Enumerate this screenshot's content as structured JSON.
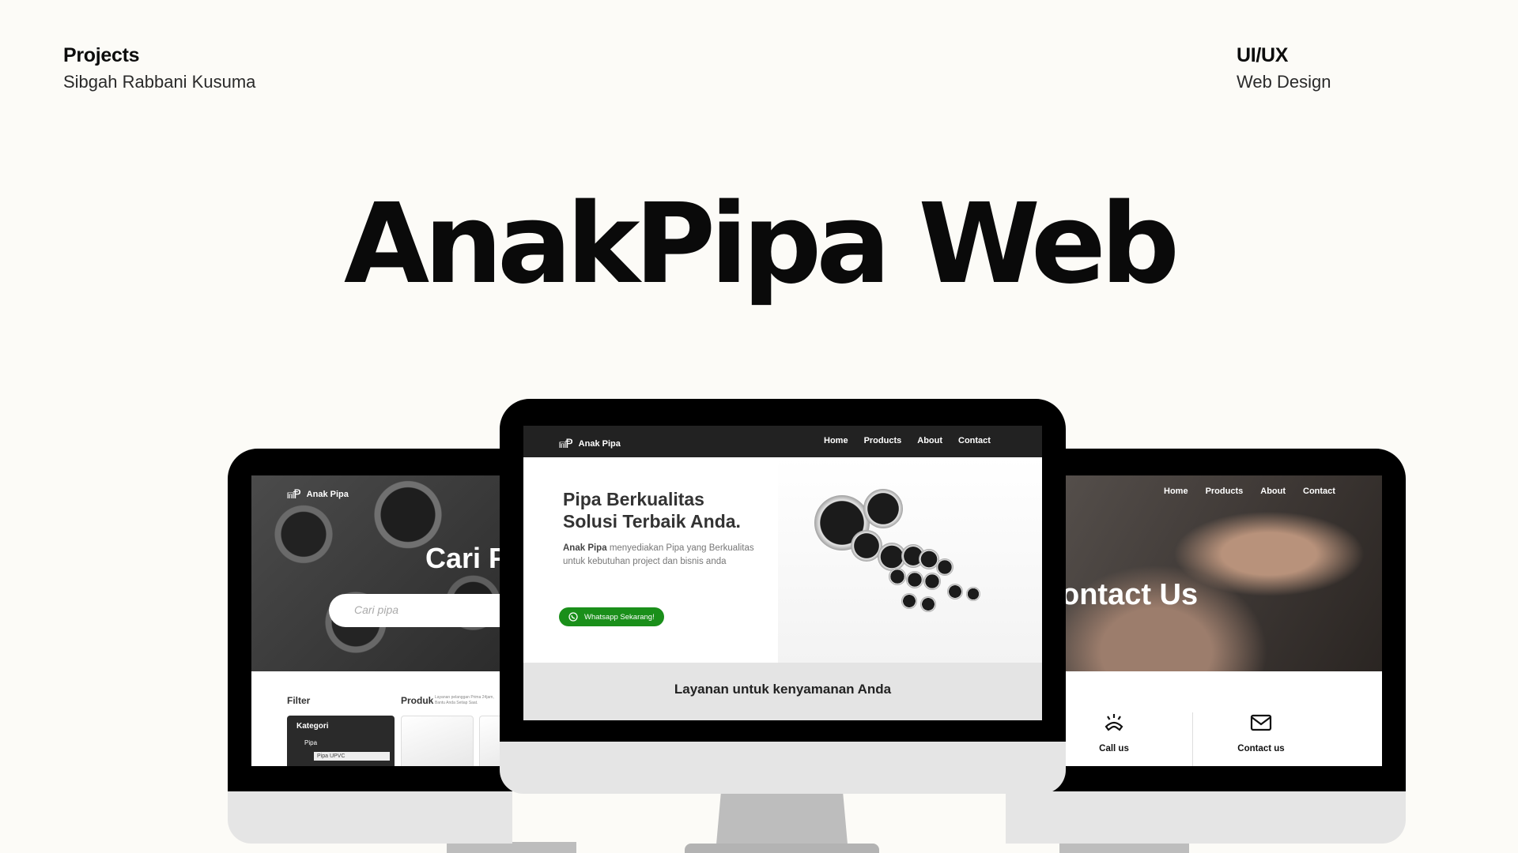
{
  "header": {
    "left_title": "Projects",
    "left_subtitle": "Sibgah Rabbani Kusuma",
    "right_title": "UI/UX",
    "right_subtitle": "Web Design"
  },
  "title": "AnakPipa Web",
  "site": {
    "brand": "Anak Pipa",
    "logo": "⩎Ᵽ",
    "nav": [
      "Home",
      "Products",
      "About",
      "Contact"
    ]
  },
  "left_screen": {
    "hero_title": "Cari P",
    "search_placeholder": "Cari pipa",
    "filter_label": "Filter",
    "produk_label": "Produk",
    "produk_note": "Layanan pelanggan Prima 24jam, Bantu Anda Setiap Saat.",
    "kategori_label": "Kategori",
    "kategori_item": "Pipa",
    "kategori_sub": "Pipa UPVC"
  },
  "center_screen": {
    "hero_title_line1": "Pipa Berkualitas",
    "hero_title_line2": "Solusi Terbaik Anda.",
    "hero_desc_brand": "Anak Pipa",
    "hero_desc_rest": "menyediakan Pipa yang Berkualitas untuk kebutuhan project dan bisnis anda",
    "whatsapp_button": "Whatsapp Sekarang!",
    "services_heading": "Layanan untuk kenyamanan Anda"
  },
  "right_screen": {
    "hero_title": "ontact Us",
    "call_label": "Call us",
    "contact_label": "Contact us"
  },
  "icons": {
    "whatsapp": "whatsapp-icon",
    "phone": "phone-icon",
    "mail": "mail-icon"
  },
  "colors": {
    "whatsapp_green": "#1a8f1a",
    "nav_dark": "#222222",
    "services_band": "#e4e4e4"
  }
}
